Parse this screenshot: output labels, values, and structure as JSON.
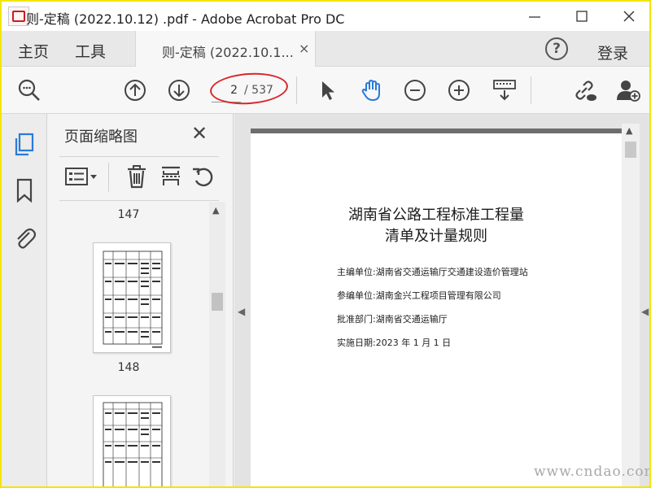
{
  "window": {
    "title": "则-定稿 (2022.10.12) .pdf - Adobe Acrobat Pro DC",
    "minimize_icon": "minimize-icon",
    "maximize_icon": "maximize-icon",
    "close_icon": "close-icon"
  },
  "tabs": {
    "home": "主页",
    "tools": "工具",
    "document": "则-定稿 (2022.10.1...",
    "document_close": "×",
    "help": "?",
    "login": "登录"
  },
  "toolbar": {
    "current_page": "2",
    "total_pages": "/ 537",
    "icons": [
      "search-zoom-icon",
      "page-up-icon",
      "page-down-icon",
      "select-pointer-icon",
      "hand-tool-icon",
      "zoom-out-icon",
      "zoom-in-icon",
      "keyboard-scroll-icon",
      "share-link-icon",
      "add-user-icon"
    ],
    "highlight_color": "#d8262b"
  },
  "navrail": {
    "icons": [
      "page-thumbnails-icon",
      "bookmarks-icon",
      "attachments-icon"
    ],
    "active_color": "#2a7ad9"
  },
  "thumbnails_pane": {
    "title": "页面缩略图",
    "close": "✕",
    "tools": [
      "thumbnail-options-icon",
      "delete-icon",
      "extract-icon",
      "rotate-icon"
    ],
    "pages": [
      {
        "label": "147"
      },
      {
        "label": "148"
      }
    ]
  },
  "document": {
    "title_line1": "湖南省公路工程标准工程量",
    "title_line2": "清单及计量规则",
    "lines": [
      "主编单位:湖南省交通运输厅交通建设造价管理站",
      "参编单位:湖南金兴工程项目管理有限公司",
      "批准部门:湖南省交通运输厅",
      "实施日期:2023 年 1 月 1 日"
    ]
  },
  "watermark": "www.cndao.com"
}
